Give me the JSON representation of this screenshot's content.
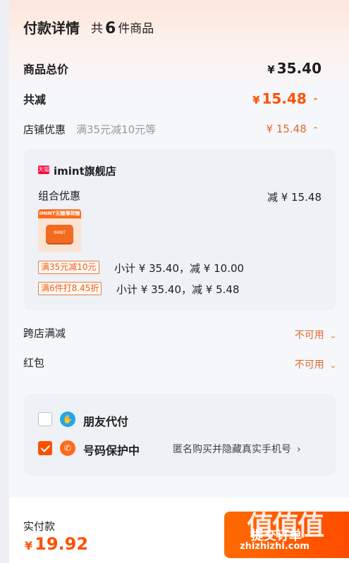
{
  "header": {
    "title": "付款详情",
    "count_prefix": "共",
    "count": "6",
    "count_suffix": "件商品"
  },
  "summary": {
    "total_label": "商品总价",
    "currency": "¥",
    "total_value": "35.40",
    "discount_label": "共减",
    "discount_value": "15.48"
  },
  "shop_promo": {
    "label": "店铺优惠",
    "detail": "满35元减10元等",
    "currency": "¥",
    "value": "15.48"
  },
  "shop_card": {
    "logo_text": "天猫",
    "shop_name": "imint旗舰店",
    "combo_label": "组合优惠",
    "combo_amount": "减 ¥ 15.48",
    "product_thumb_text": "IMINT无糖薄荷糖",
    "product_tin_text": "IMINT",
    "promos": [
      {
        "tag": "满35元减10元",
        "text": "小计 ¥ 35.40，减 ¥ 10.00"
      },
      {
        "tag": "满6件打8.45折",
        "text": "小计 ¥ 35.40，减 ¥ 5.48"
      }
    ]
  },
  "cross_store": {
    "label": "跨店满减",
    "status": "不可用"
  },
  "red_packet": {
    "label": "红包",
    "status": "不可用"
  },
  "payment": {
    "friend_pay_label": "朋友代付",
    "friend_pay_checked": false,
    "privacy_label": "号码保护中",
    "privacy_checked": true,
    "privacy_hint": "匿名购买并隐藏真实手机号"
  },
  "footer": {
    "paid_label": "实付款",
    "currency": "¥",
    "paid_value": "19.92",
    "submit_label": "提交订单"
  },
  "watermark": {
    "text": "值值值",
    "site": "zhizhizhi.com"
  },
  "colors": {
    "accent": "#ff5000",
    "soft_accent": "#e06a2b",
    "card_bg": "#eef1f6"
  },
  "icons": [
    "chevron-up-icon",
    "chevron-down-icon",
    "chevron-right-icon",
    "hand-heart-icon",
    "shield-phone-icon",
    "check-icon"
  ]
}
